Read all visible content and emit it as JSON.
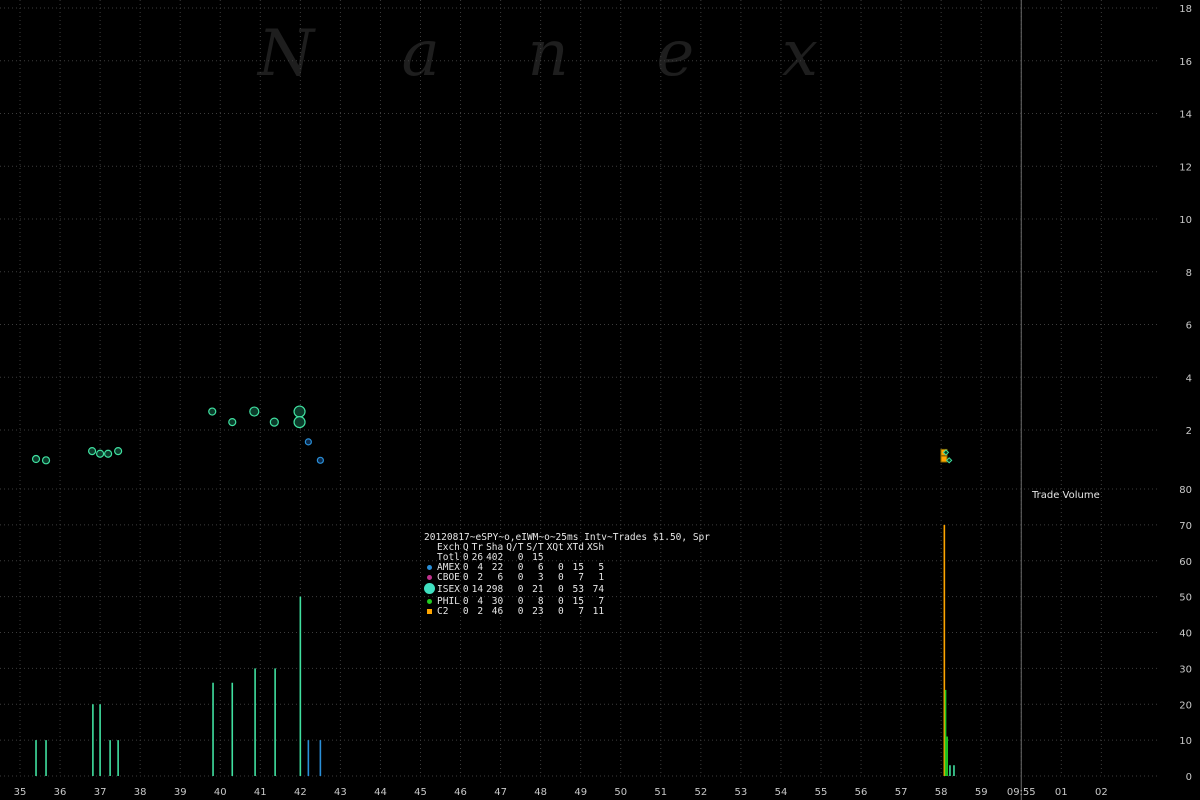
{
  "watermark": "N a n e x",
  "chart_data": [
    {
      "type": "scatter",
      "title": "",
      "xlabel": "",
      "ylabel": "",
      "x_ticks": [
        "35",
        "36",
        "37",
        "38",
        "39",
        "40",
        "41",
        "42",
        "43",
        "44",
        "45",
        "46",
        "47",
        "48",
        "49",
        "50",
        "51",
        "52",
        "53",
        "54",
        "55",
        "56",
        "57",
        "58",
        "59",
        "09:55",
        "01",
        "02"
      ],
      "y_ticks": [
        2,
        4,
        6,
        8,
        10,
        12,
        14,
        16,
        18
      ],
      "ylim": [
        0.15,
        18
      ],
      "series": [
        {
          "exchange": "ISEX",
          "color": "#40e0a0",
          "points": [
            {
              "x": 35.4,
              "y": 0.9,
              "size": 7
            },
            {
              "x": 35.65,
              "y": 0.85,
              "size": 7
            },
            {
              "x": 36.8,
              "y": 1.2,
              "size": 7
            },
            {
              "x": 37.0,
              "y": 1.1,
              "size": 7
            },
            {
              "x": 37.2,
              "y": 1.1,
              "size": 7
            },
            {
              "x": 37.45,
              "y": 1.2,
              "size": 7
            },
            {
              "x": 39.8,
              "y": 2.7,
              "size": 7
            },
            {
              "x": 40.3,
              "y": 2.3,
              "size": 7
            },
            {
              "x": 40.85,
              "y": 2.7,
              "size": 9
            },
            {
              "x": 41.35,
              "y": 2.3,
              "size": 8
            },
            {
              "x": 41.98,
              "y": 2.7,
              "size": 11
            },
            {
              "x": 41.98,
              "y": 2.3,
              "size": 11
            }
          ]
        },
        {
          "exchange": "AMEX",
          "color": "#2a8fd8",
          "points": [
            {
              "x": 42.2,
              "y": 1.55,
              "size": 6
            },
            {
              "x": 42.5,
              "y": 0.85,
              "size": 6
            }
          ]
        },
        {
          "exchange": "C2",
          "color": "#ffa500",
          "points": [
            {
              "x": 58.07,
              "y": 0.9,
              "size": 6
            },
            {
              "x": 58.07,
              "y": 1.15,
              "size": 6
            }
          ]
        },
        {
          "exchange": "PHIL",
          "color": "#22cc22",
          "points": [
            {
              "x": 58.12,
              "y": 1.15,
              "size": 5
            },
            {
              "x": 58.2,
              "y": 0.85,
              "size": 5
            }
          ]
        }
      ]
    },
    {
      "type": "bar",
      "title": "Trade Volume",
      "y_ticks": [
        0,
        10,
        20,
        30,
        40,
        50,
        60,
        70,
        80
      ],
      "ylim": [
        0,
        80
      ],
      "bars": [
        {
          "x": 35.4,
          "value": 10,
          "color": "#40e0a0"
        },
        {
          "x": 35.65,
          "value": 10,
          "color": "#40e0a0"
        },
        {
          "x": 36.82,
          "value": 20,
          "color": "#40e0a0"
        },
        {
          "x": 37.0,
          "value": 20,
          "color": "#40e0a0"
        },
        {
          "x": 37.25,
          "value": 10,
          "color": "#40e0a0"
        },
        {
          "x": 37.45,
          "value": 10,
          "color": "#40e0a0"
        },
        {
          "x": 39.82,
          "value": 26,
          "color": "#40e0a0"
        },
        {
          "x": 40.3,
          "value": 26,
          "color": "#40e0a0"
        },
        {
          "x": 40.87,
          "value": 30,
          "color": "#40e0a0"
        },
        {
          "x": 41.37,
          "value": 30,
          "color": "#40e0a0"
        },
        {
          "x": 42.0,
          "value": 50,
          "color": "#40e0a0"
        },
        {
          "x": 42.2,
          "value": 10,
          "color": "#2a8fd8"
        },
        {
          "x": 42.5,
          "value": 10,
          "color": "#2a8fd8"
        },
        {
          "x": 58.08,
          "value": 70,
          "color": "#ffa500"
        },
        {
          "x": 58.11,
          "value": 24,
          "color": "#22cc22"
        },
        {
          "x": 58.15,
          "value": 11,
          "color": "#22cc22"
        },
        {
          "x": 58.22,
          "value": 3,
          "color": "#40e0a0"
        },
        {
          "x": 58.32,
          "value": 3,
          "color": "#40e0a0"
        }
      ]
    }
  ],
  "legend": {
    "title": "20120817~eSPY~o,eIWM~o~25ms Intv~Trades $1.50, Spr",
    "headers": [
      "Exch",
      "Q",
      "Tr",
      "Sha",
      "Q/T",
      "S/T",
      "XQt",
      "XTd",
      "XSh"
    ],
    "rows": [
      {
        "name": "Totl",
        "color": "",
        "shape": "none",
        "Q": "0",
        "Tr": "26",
        "Sha": "402",
        "QT": "0",
        "ST": "15",
        "XQt": "",
        "XTd": "",
        "XSh": ""
      },
      {
        "name": "AMEX",
        "color": "#2a8fd8",
        "shape": "dot",
        "Q": "0",
        "Tr": "4",
        "Sha": "22",
        "QT": "0",
        "ST": "6",
        "XQt": "0",
        "XTd": "15",
        "XSh": "5"
      },
      {
        "name": "CBOE",
        "color": "#c0338f",
        "shape": "dot",
        "Q": "0",
        "Tr": "2",
        "Sha": "6",
        "QT": "0",
        "ST": "3",
        "XQt": "0",
        "XTd": "7",
        "XSh": "1"
      },
      {
        "name": "ISEX",
        "color": "#40e0c0",
        "shape": "bigdot",
        "Q": "0",
        "Tr": "14",
        "Sha": "298",
        "QT": "0",
        "ST": "21",
        "XQt": "0",
        "XTd": "53",
        "XSh": "74"
      },
      {
        "name": "PHIL",
        "color": "#22cc22",
        "shape": "dot",
        "Q": "0",
        "Tr": "4",
        "Sha": "30",
        "QT": "0",
        "ST": "8",
        "XQt": "0",
        "XTd": "15",
        "XSh": "7"
      },
      {
        "name": "C2",
        "color": "#ffa500",
        "shape": "sq",
        "Q": "0",
        "Tr": "2",
        "Sha": "46",
        "QT": "0",
        "ST": "23",
        "XQt": "0",
        "XTd": "7",
        "XSh": "11"
      }
    ]
  }
}
